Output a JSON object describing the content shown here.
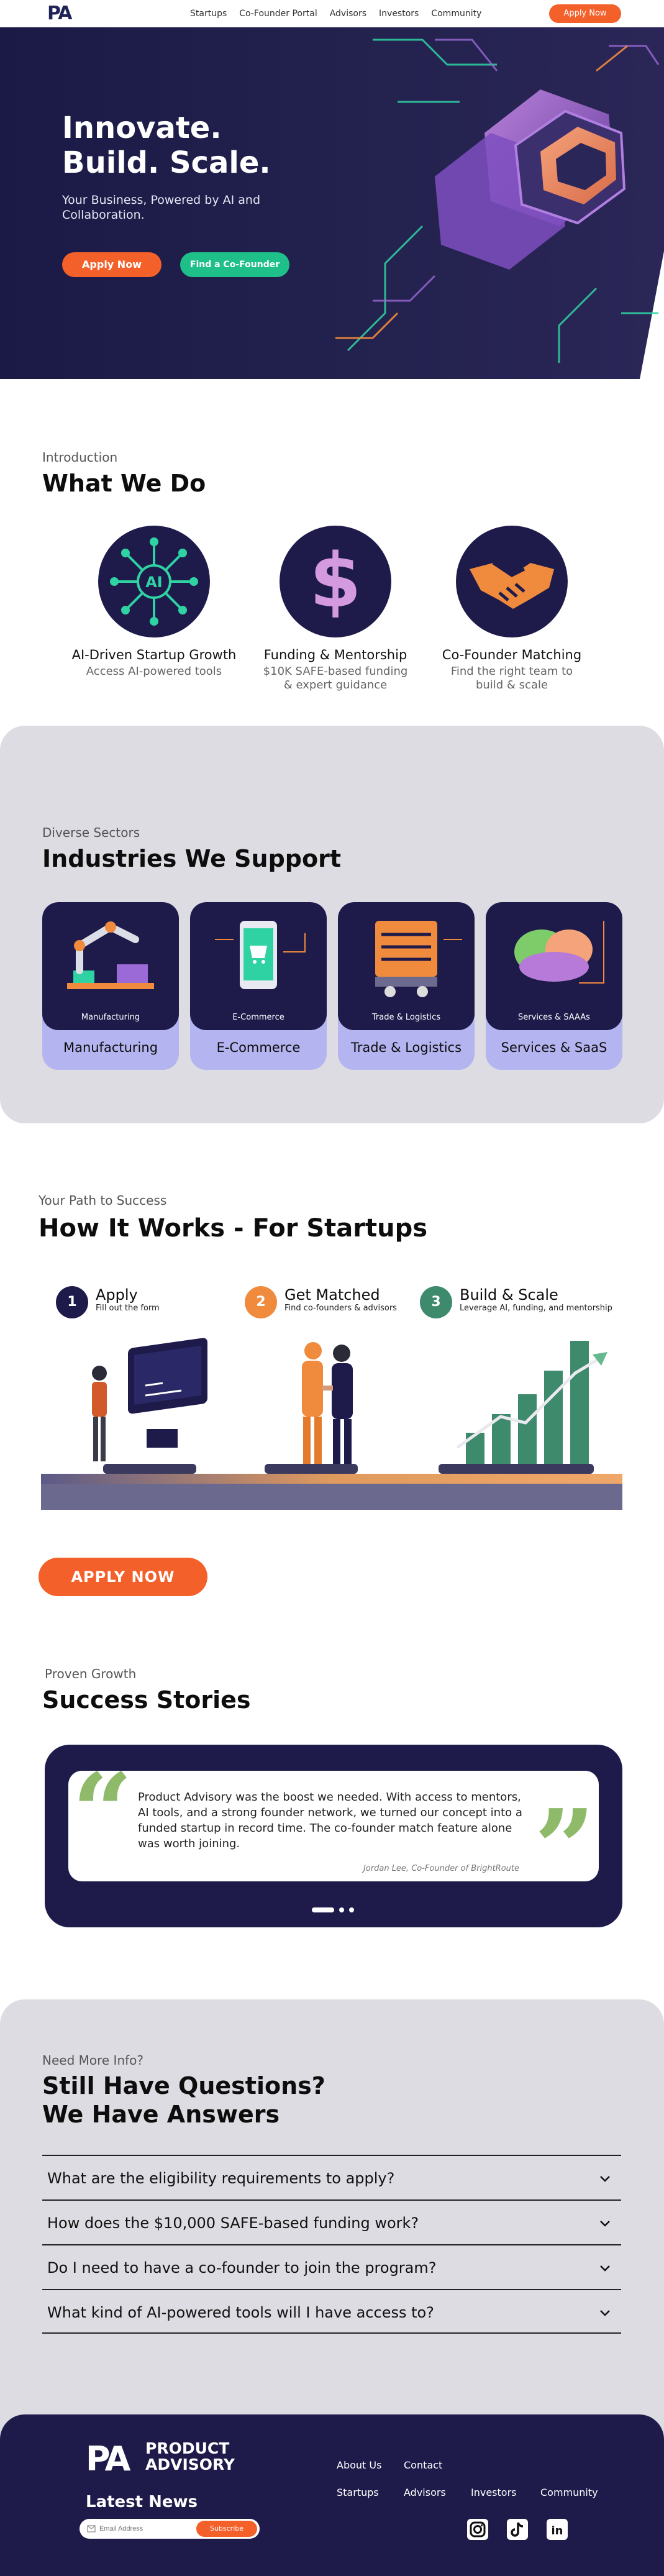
{
  "nav": {
    "logo": "PA",
    "links": [
      "Startups",
      "Co-Founder Portal",
      "Advisors",
      "Investors",
      "Community"
    ],
    "apply_label": "Apply Now"
  },
  "hero": {
    "title": "Innovate.\nBuild. Scale.",
    "subtitle": "Your Business, Powered by AI and\nCollaboration.",
    "apply_label": "Apply Now",
    "cofounder_label": "Find a Co-Founder"
  },
  "what_we_do": {
    "eyebrow": "Introduction",
    "heading": "What We Do",
    "items": [
      {
        "title": "AI-Driven Startup Growth",
        "desc": "Access AI-powered tools",
        "icon": "ai-network-icon"
      },
      {
        "title": "Funding & Mentorship",
        "desc": "$10K SAFE-based funding\n& expert guidance",
        "icon": "dollar-icon"
      },
      {
        "title": "Co-Founder Matching",
        "desc": "Find the right team to\nbuild & scale",
        "icon": "handshake-icon"
      }
    ]
  },
  "industries": {
    "eyebrow": "Diverse Sectors",
    "heading": "Industries We Support",
    "items": [
      {
        "inner_label": "Manufacturing",
        "label": "Manufacturing",
        "icon": "robot-arm-icon"
      },
      {
        "inner_label": "E-Commerce",
        "label": "E-Commerce",
        "icon": "phone-cart-icon"
      },
      {
        "inner_label": "Trade & Logistics",
        "label": "Trade & Logistics",
        "icon": "truck-icon"
      },
      {
        "inner_label": "Services & SAAAs",
        "label": "Services & SaaS",
        "icon": "cloud-icon"
      }
    ]
  },
  "how_it_works": {
    "eyebrow": "Your Path to Success",
    "heading": "How It Works - For Startups",
    "steps": [
      {
        "num": "1",
        "title": "Apply",
        "sub": "Fill out the form",
        "color": "#1e1b4b"
      },
      {
        "num": "2",
        "title": "Get Matched",
        "sub": "Find co-founders & advisors",
        "color": "#f08a3c"
      },
      {
        "num": "3",
        "title": "Build & Scale",
        "sub": "Leverage AI, funding, and mentorship",
        "color": "#3e8a6c"
      }
    ],
    "cta": "APPLY NOW"
  },
  "success": {
    "eyebrow": "Proven Growth",
    "heading": "Success Stories",
    "quote": "Product Advisory was the boost we needed. With access to mentors, AI tools, and a strong founder network, we turned our concept into a funded startup in record time. The co-founder match feature alone was worth joining.",
    "author": "Jordan Lee, Co-Founder of BrightRoute"
  },
  "faq": {
    "eyebrow": "Need More Info?",
    "heading": "Still Have Questions?\nWe Have Answers",
    "questions": [
      "What are the eligibility requirements to apply?",
      "How does the $10,000 SAFE-based funding work?",
      "Do I need to have a co-founder to join the program?",
      "What kind of AI-powered tools will I have access to?"
    ]
  },
  "footer": {
    "logo": "PA",
    "brand": "PRODUCT\nADVISORY",
    "newsletter": "Latest News",
    "email_placeholder": "Email Address",
    "subscribe_label": "Subscribe",
    "links_row1": [
      "About Us",
      "Contact"
    ],
    "links_row2": [
      "Startups",
      "Advisors",
      "Investors",
      "Community"
    ],
    "social": [
      "instagram-icon",
      "tiktok-icon",
      "linkedin-icon"
    ]
  },
  "colors": {
    "accent_orange": "#f4602a",
    "accent_green": "#1fbf8a",
    "navy": "#1e1b4b",
    "lavender": "#b3b4f0",
    "section_gray": "#dcdce2"
  }
}
